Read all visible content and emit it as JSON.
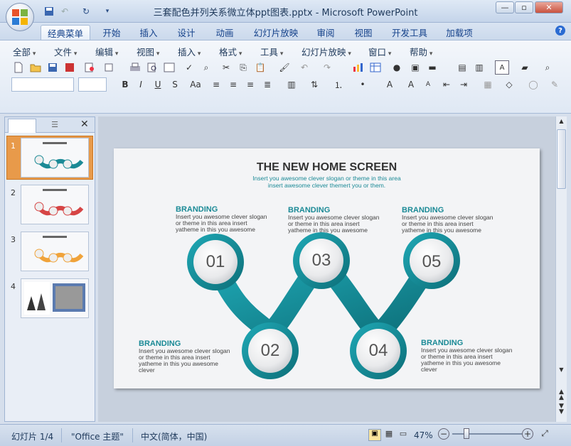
{
  "window": {
    "title": "三套配色并列关系微立体ppt图表.pptx - Microsoft PowerPoint",
    "minimize": "—",
    "maximize": "▫",
    "close": "✕"
  },
  "tabs": [
    "经典菜单",
    "开始",
    "插入",
    "设计",
    "动画",
    "幻灯片放映",
    "审阅",
    "视图",
    "开发工具",
    "加载项"
  ],
  "menus": [
    "全部",
    "文件",
    "编辑",
    "视图",
    "插入",
    "格式",
    "工具",
    "幻灯片放映",
    "窗口",
    "帮助"
  ],
  "slides_pane": {
    "numbers": [
      "1",
      "2",
      "3",
      "4"
    ],
    "close": "✕"
  },
  "slide": {
    "title": "THE NEW HOME SCREEN",
    "subtitle1": "Insert you awesome clever slogan or theme in this area",
    "subtitle2": "insert awesome clever themert you or them.",
    "items": [
      {
        "num": "01",
        "brand": "BRANDING",
        "text": [
          "Insert you awesome clever slogan",
          "or theme in this area insert",
          "yatheme in this you awesome"
        ]
      },
      {
        "num": "02",
        "brand": "BRANDING",
        "text": [
          "Insert you awesome clever slogan",
          "or theme in this area insert",
          "yatheme in this you awesome",
          "clever"
        ]
      },
      {
        "num": "03",
        "brand": "BRANDING",
        "text": [
          "Insert you awesome clever slogan",
          "or theme in this area insert",
          "yatheme in this you awesome"
        ]
      },
      {
        "num": "04",
        "brand": "BRANDING",
        "text": [
          "Insert you awesome clever slogan",
          "or theme in this area insert",
          "yatheme in this you awesome",
          "clever"
        ]
      },
      {
        "num": "05",
        "brand": "BRANDING",
        "text": [
          "Insert you awesome clever slogan",
          "or theme in this area insert",
          "yatheme in this you awesome"
        ]
      }
    ],
    "accent": "#1b8a96"
  },
  "status": {
    "slide_info": "幻灯片 1/4",
    "theme": "\"Office 主题\"",
    "language": "中文(简体，中国)",
    "zoom": "47%",
    "zoom_fraction": 0.47
  }
}
